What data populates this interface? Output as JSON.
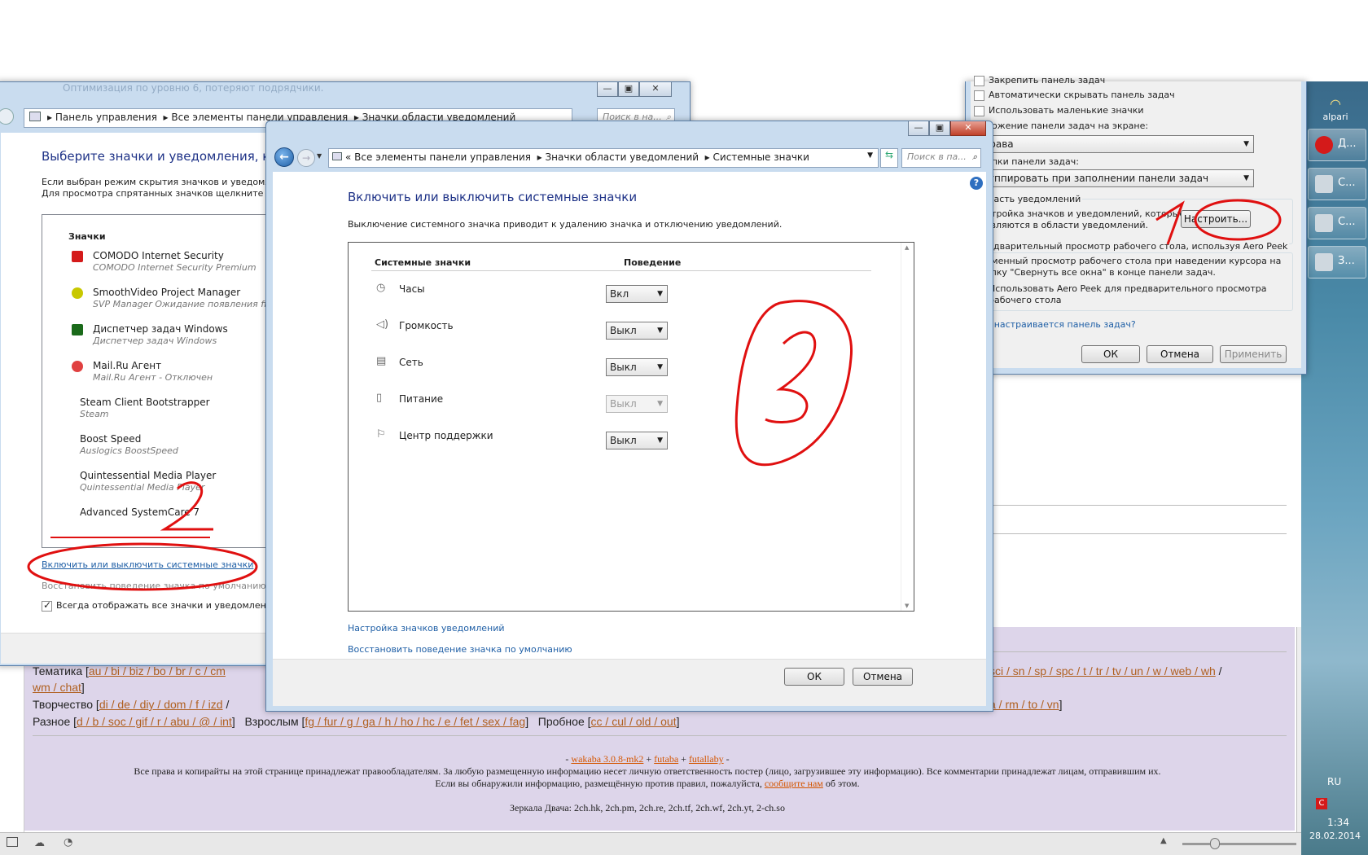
{
  "left_window": {
    "breadcrumb": [
      "Панель управления",
      "Все элементы панели управления",
      "Значки области уведомлений"
    ],
    "title": "Выберите значки и уведомления, кото",
    "desc_line1": "Если выбран режим скрытия значков и уведомле",
    "desc_line2": "Для просмотра спрятанных значков щелкните ст",
    "list_header": "Значки",
    "items": [
      {
        "name": "COMODO Internet Security",
        "sub": "COMODO Internet Security Premium"
      },
      {
        "name": "SmoothVideo Project Manager",
        "sub": "SVP Manager Ожидание появления ff"
      },
      {
        "name": "Диспетчер задач Windows",
        "sub": "Диспетчер задач Windows"
      },
      {
        "name": "Mail.Ru Агент",
        "sub": "Mail.Ru Агент - Отключен"
      },
      {
        "name": "Steam Client Bootstrapper",
        "sub": "Steam"
      },
      {
        "name": "Boost Speed",
        "sub": "Auslogics BoostSpeed"
      },
      {
        "name": "Quintessential Media Player",
        "sub": "Quintessential Media Player"
      },
      {
        "name": "Advanced SystemCare 7",
        "sub": ""
      }
    ],
    "link_system_icons": "Включить или выключить системные значки",
    "link_restore": "Восстановить поведение значка по умолчанию",
    "always_show": "Всегда отображать все значки и уведомления н",
    "search_placeholder": "Поиск в на...",
    "blurred_top": "Оптимизация по уровню 6, потеряют подрядчики."
  },
  "main_window": {
    "breadcrumb_prefix": "«",
    "breadcrumb": [
      "Все элементы панели управления",
      "Значки области уведомлений",
      "Системные значки"
    ],
    "search_placeholder": "Поиск в па...",
    "help": "?",
    "title": "Включить или выключить системные значки",
    "description": "Выключение системного значка приводит к удалению значка и отключению уведомлений.",
    "col_icons": "Системные значки",
    "col_behavior": "Поведение",
    "rows": [
      {
        "name": "Часы",
        "value": "Вкл",
        "enabled": true,
        "icon": "clock-icon"
      },
      {
        "name": "Громкость",
        "value": "Выкл",
        "enabled": true,
        "icon": "volume-icon"
      },
      {
        "name": "Сеть",
        "value": "Выкл",
        "enabled": true,
        "icon": "network-icon"
      },
      {
        "name": "Питание",
        "value": "Выкл",
        "enabled": false,
        "icon": "power-icon"
      },
      {
        "name": "Центр поддержки",
        "value": "Выкл",
        "enabled": true,
        "icon": "flag-icon"
      }
    ],
    "link_customize": "Настройка значков уведомлений",
    "link_restore": "Восстановить поведение значка по умолчанию",
    "ok": "ОК",
    "cancel": "Отмена"
  },
  "taskbar_props": {
    "cb1": "Закрепить панель задач",
    "cb2": "Автоматически скрывать панель задач",
    "cb3": "Использовать маленькие значки",
    "position_label": "Положение панели задач на экране:",
    "position_value": "Справа",
    "buttons_label": "Кнопки панели задач:",
    "buttons_value": "Группировать при заполнении панели задач",
    "notif_group": "Область уведомлений",
    "notif_text1": "Настройка значков и уведомлений, которые",
    "notif_text2": "появляются в области уведомлений.",
    "customize_btn": "Настроить...",
    "peek_group": "Предварительный просмотр рабочего стола, используя Aero Peek",
    "peek_text1": "Временный просмотр рабочего стола при наведении курсора на",
    "peek_text2": "кнопку \"Свернуть все окна\" в конце панели задач.",
    "peek_cb1": "Использовать Aero Peek для предварительного просмотра",
    "peek_cb2": "рабочего стола",
    "help_link": "Как настраивается панель задач?",
    "ok": "ОК",
    "cancel": "Отмена",
    "apply": "Применить"
  },
  "forum": {
    "row1_label": "Тематика",
    "row1a": [
      "au",
      "bi",
      "biz",
      "bo",
      "br",
      "c",
      "cm"
    ],
    "row1b": [
      "sci",
      "sn",
      "sp",
      "spc",
      "t",
      "tr",
      "tv",
      "un",
      "w",
      "web",
      "wh"
    ],
    "row1c": [
      "wm",
      "chat"
    ],
    "row2_label": "Творчество",
    "row2a": [
      "di",
      "de",
      "diy",
      "dom",
      "f",
      "izd"
    ],
    "row2b": [
      "a",
      "rm",
      "to",
      "vn"
    ],
    "row3_label": "Разное",
    "row3": [
      "d",
      "b",
      "soc",
      "gif",
      "r",
      "abu",
      "@",
      "int"
    ],
    "row3b_label": "Взрослым",
    "row3b": [
      "fg",
      "fur",
      "g",
      "ga",
      "h",
      "ho",
      "hc",
      "e",
      "fet",
      "sex",
      "fag"
    ],
    "row3c_label": "Пробное",
    "row3c": [
      "cc",
      "cul",
      "old",
      "out"
    ],
    "footer_links": [
      "wakaba 3.0.8-mk2",
      "futaba",
      "futallaby"
    ],
    "footer_line2": "Все права и копирайты на этой странице принадлежат правообладателям. За любую размещенную информацию несет личную ответственность постер (лицо, загрузившее эту информацию). Все комментарии принадлежат лицам, отправившим их.",
    "footer_line3a": "Если вы обнаружили информацию, размещённую против правил, пожалуйста,",
    "footer_line3_link": "сообщите нам",
    "footer_line3b": "об этом.",
    "mirrors": "Зеркала Двача: 2ch.hk, 2ch.pm, 2ch.re, 2ch.tf, 2ch.wf, 2ch.yt, 2-ch.so"
  },
  "taskbar": {
    "logo": "alpari",
    "items": [
      {
        "label": "Д...",
        "color": "#d41a1a"
      },
      {
        "label": "С...",
        "color": "#cfd8df"
      },
      {
        "label": "С...",
        "color": "#cfd8df"
      },
      {
        "label": "З...",
        "color": "#cfd8df"
      }
    ],
    "lang": "RU",
    "time": "1:34",
    "date": "28.02.2014"
  },
  "annotations": [
    "1",
    "2",
    "3"
  ]
}
